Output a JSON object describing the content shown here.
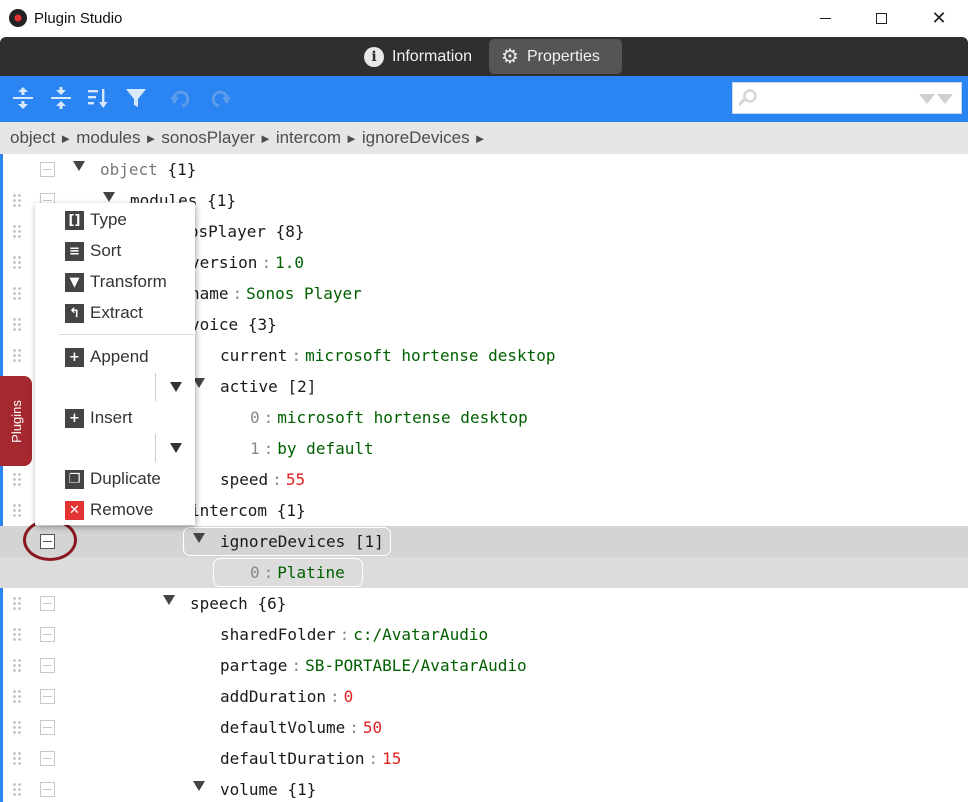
{
  "window": {
    "title": "Plugin Studio"
  },
  "tabs": [
    {
      "label": "Information",
      "icon": "info-icon"
    },
    {
      "label": "Properties",
      "icon": "gear-icon",
      "active": true
    }
  ],
  "toolbar": {
    "icons": [
      "expand-all-icon",
      "collapse-all-icon",
      "sort-icon",
      "filter-icon",
      "undo-icon",
      "redo-icon"
    ],
    "search": {
      "value": "",
      "placeholder": ""
    }
  },
  "breadcrumb": [
    "object",
    "modules",
    "sonosPlayer",
    "intercom",
    "ignoreDevices"
  ],
  "tree": {
    "object": {
      "key": "object",
      "count": "{1}"
    },
    "modules": {
      "key": "modules",
      "count": "{1}"
    },
    "sonosPlayer": {
      "key": "sonosPlayer",
      "count": "{8}"
    },
    "version": {
      "key": "version",
      "value": "1.0"
    },
    "name": {
      "key": "name",
      "value": "Sonos Player"
    },
    "voice": {
      "key": "voice",
      "count": "{3}"
    },
    "current": {
      "key": "current",
      "value": "microsoft hortense desktop"
    },
    "active": {
      "key": "active",
      "count": "[2]"
    },
    "active0": {
      "key": "0",
      "value": "microsoft hortense desktop"
    },
    "active1": {
      "key": "1",
      "value": "by default"
    },
    "speed": {
      "key": "speed",
      "value": "55"
    },
    "intercom": {
      "key": "intercom",
      "count": "{1}"
    },
    "ignoreDevices": {
      "key": "ignoreDevices",
      "count": "[1]"
    },
    "ignore0": {
      "key": "0",
      "value": "Platine"
    },
    "speech": {
      "key": "speech",
      "count": "{6}"
    },
    "sharedFolder": {
      "key": "sharedFolder",
      "value": "c:/AvatarAudio"
    },
    "partage": {
      "key": "partage",
      "value": "SB-PORTABLE/AvatarAudio"
    },
    "addDuration": {
      "key": "addDuration",
      "value": "0"
    },
    "defaultVolume": {
      "key": "defaultVolume",
      "value": "50"
    },
    "defaultDuration": {
      "key": "defaultDuration",
      "value": "15"
    },
    "volume": {
      "key": "volume",
      "count": "{1}"
    }
  },
  "separator": ":",
  "plugins_tab": {
    "label": "Plugins"
  },
  "context_menu": {
    "type": "Type",
    "sort": "Sort",
    "transform": "Transform",
    "extract": "Extract",
    "append": "Append",
    "insert": "Insert",
    "duplicate": "Duplicate",
    "remove": "Remove"
  },
  "colors": {
    "accent": "#2a84f2",
    "tabbar": "#2f2f2f",
    "string": "#006000",
    "number": "#e02020",
    "plugins": "#a4282f"
  }
}
